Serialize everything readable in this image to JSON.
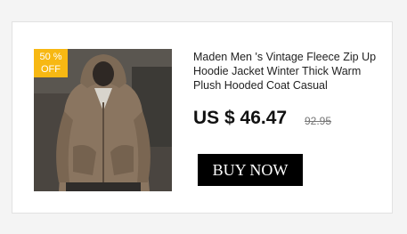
{
  "product": {
    "title": "Maden Men  's Vintage Fleece Zip Up Hoodie Jacket Winter Thick Warm Plush Hooded Coat Casual",
    "discount_badge": {
      "percent": "50 %",
      "label": "OFF"
    },
    "price": "US $ 46.47",
    "old_price": "92.95",
    "buy_label": "BUY NOW"
  },
  "colors": {
    "badge": "#f7b813",
    "button": "#000000",
    "jacket": "#8a7560"
  }
}
